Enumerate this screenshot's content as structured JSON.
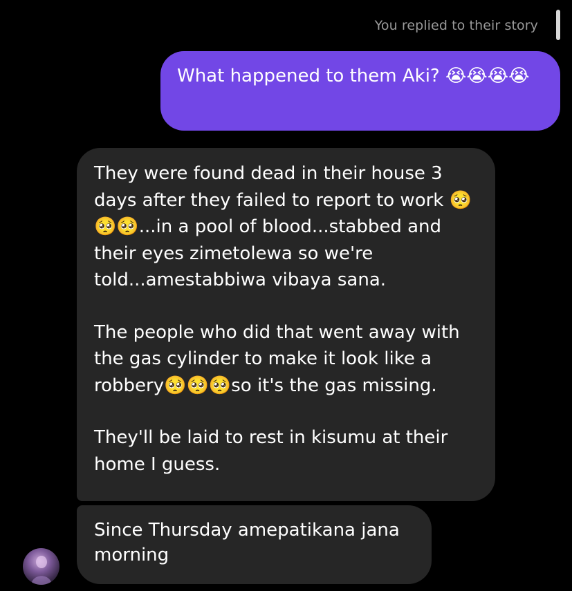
{
  "header": {
    "story_reply_label": "You replied to their story"
  },
  "messages": {
    "sent": {
      "text": "What happened to them Aki? 😭😭😭😭"
    },
    "received_main": {
      "paragraphs": [
        "They were found dead in their house 3 days after they failed to report to work 🥺🥺🥺...in a pool of blood...stabbed and their eyes zimetolewa so we're told...amestabbiwa vibaya sana.",
        "The people who did that went away with the gas cylinder to make it look like a robbery🥺🥺🥺so it's the gas missing.",
        "They'll be laid to rest in kisumu at their home I guess."
      ]
    },
    "received_last": {
      "text": "Since Thursday amepatikana jana morning"
    }
  },
  "colors": {
    "background": "#000000",
    "sent_bubble": "#7247e6",
    "received_bubble": "#262626",
    "muted_text": "#9a9a9a"
  },
  "icons": {
    "avatar": "profile-avatar",
    "reply_indicator": "story-reply-bar"
  }
}
